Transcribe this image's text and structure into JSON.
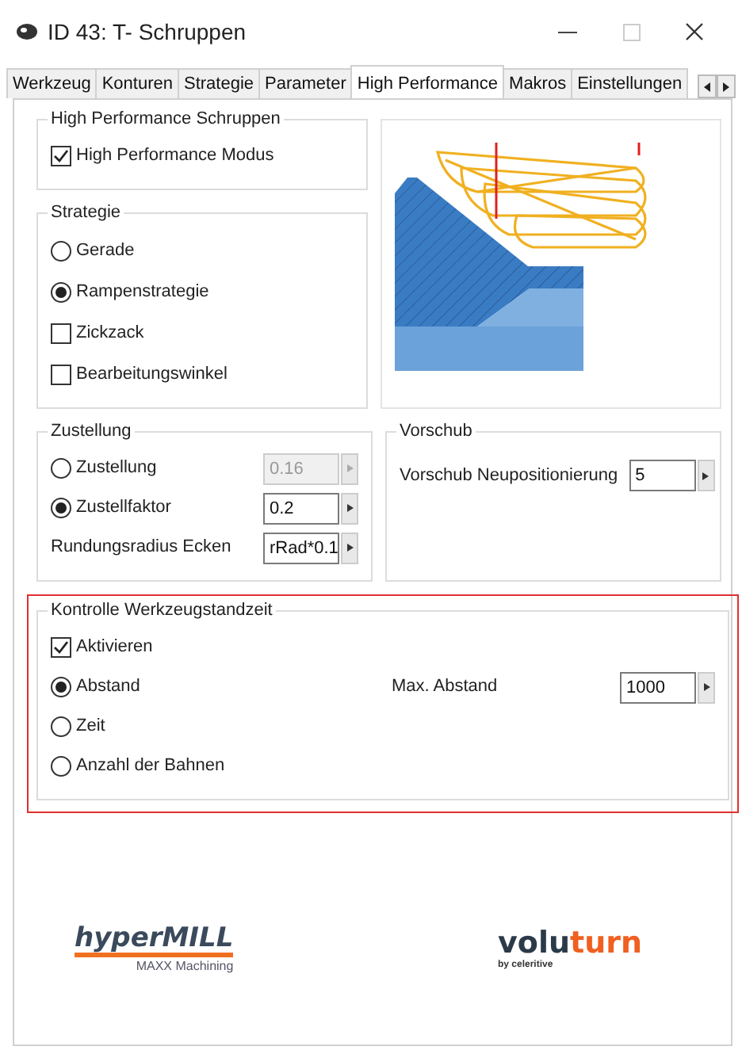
{
  "window": {
    "title": "ID 43: T- Schruppen"
  },
  "tabs": [
    {
      "label": "Werkzeug",
      "selected": false
    },
    {
      "label": "Konturen",
      "selected": false
    },
    {
      "label": "Strategie",
      "selected": false
    },
    {
      "label": "Parameter",
      "selected": false
    },
    {
      "label": "High Performance",
      "selected": true
    },
    {
      "label": "Makros",
      "selected": false
    },
    {
      "label": "Einstellungen",
      "selected": false
    }
  ],
  "hp_group": {
    "title": "High Performance Schruppen",
    "checkbox": {
      "label": "High Performance Modus",
      "checked": true
    }
  },
  "strategie": {
    "title": "Strategie",
    "options": [
      {
        "kind": "radio",
        "label": "Gerade",
        "selected": false
      },
      {
        "kind": "radio",
        "label": "Rampenstrategie",
        "selected": true
      },
      {
        "kind": "checkbox",
        "label": "Zickzack",
        "checked": false
      },
      {
        "kind": "checkbox",
        "label": "Bearbeitungswinkel",
        "checked": false
      }
    ]
  },
  "zustellung": {
    "title": "Zustellung",
    "rows": [
      {
        "kind": "radio",
        "label": "Zustellung",
        "selected": false,
        "value": "0.16",
        "disabled": true
      },
      {
        "kind": "radio",
        "label": "Zustellfaktor",
        "selected": true,
        "value": "0.2",
        "disabled": false
      },
      {
        "kind": "label",
        "label": "Rundungsradius Ecken",
        "value": "rRad*0.1",
        "disabled": false
      }
    ]
  },
  "vorschub": {
    "title": "Vorschub",
    "field": {
      "label": "Vorschub Neupositionierung",
      "value": "5"
    }
  },
  "kontrolle": {
    "title": "Kontrolle Werkzeugstandzeit",
    "highlighted": true,
    "checkbox": {
      "label": "Aktivieren",
      "checked": true
    },
    "options": [
      {
        "label": "Abstand",
        "selected": true
      },
      {
        "label": "Zeit",
        "selected": false
      },
      {
        "label": "Anzahl der Bahnen",
        "selected": false
      }
    ],
    "field": {
      "label": "Max. Abstand",
      "value": "1000"
    }
  },
  "logos": {
    "hypermill": {
      "name": "hyperMILL",
      "tagline": "MAXX Machining"
    },
    "voluturn": {
      "name_parts": [
        "volu",
        "turn"
      ],
      "tagline": "by celeritive"
    }
  }
}
